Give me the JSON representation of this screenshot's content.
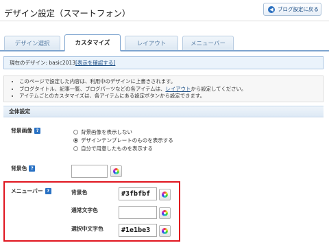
{
  "header": {
    "title": "デザイン設定（スマートフォン）",
    "back_button": "ブログ設定に戻る",
    "back_icon": "arrow-left-icon"
  },
  "tabs": [
    {
      "label": "デザイン選択",
      "active": false
    },
    {
      "label": "カスタマイズ",
      "active": true
    },
    {
      "label": "レイアウト",
      "active": false
    },
    {
      "label": "メニューバー",
      "active": false
    }
  ],
  "current_design": {
    "prefix": "現在のデザイン: basic2013",
    "link": "[表示を確認する]"
  },
  "notes": [
    {
      "text": "このページで設定した内容は、利用中のデザインに上書きされます。"
    },
    {
      "before": "ブログタイトル、記事一覧、ブログパーツなどの各アイテムは、",
      "link": "レイアウト",
      "after": "から設定してください。"
    },
    {
      "text": "アイテムごとのカスタマイズは、各アイテムにある設定ボタンから設定できます。"
    }
  ],
  "section_title": "全体設定",
  "help_label": "?",
  "bg_image": {
    "label": "背景画像",
    "options": [
      {
        "label": "背景画像を表示しない",
        "selected": false
      },
      {
        "label": "デザインテンプレートのものを表示する",
        "selected": true
      },
      {
        "label": "自分で用意したものを表示する",
        "selected": false
      }
    ]
  },
  "bg_color": {
    "label": "背景色",
    "value": ""
  },
  "menubar": {
    "label": "メニューバー",
    "bg_color": {
      "label": "背景色",
      "value": "#3fbfbf"
    },
    "text_color": {
      "label": "通常文字色",
      "value": ""
    },
    "selected_text_color": {
      "label": "選択中文字色",
      "value": "#1e1be3"
    }
  },
  "colors": {
    "accent": "#2a72c4",
    "tab_border": "#7da4cf",
    "highlight_box": "#e0141e"
  }
}
